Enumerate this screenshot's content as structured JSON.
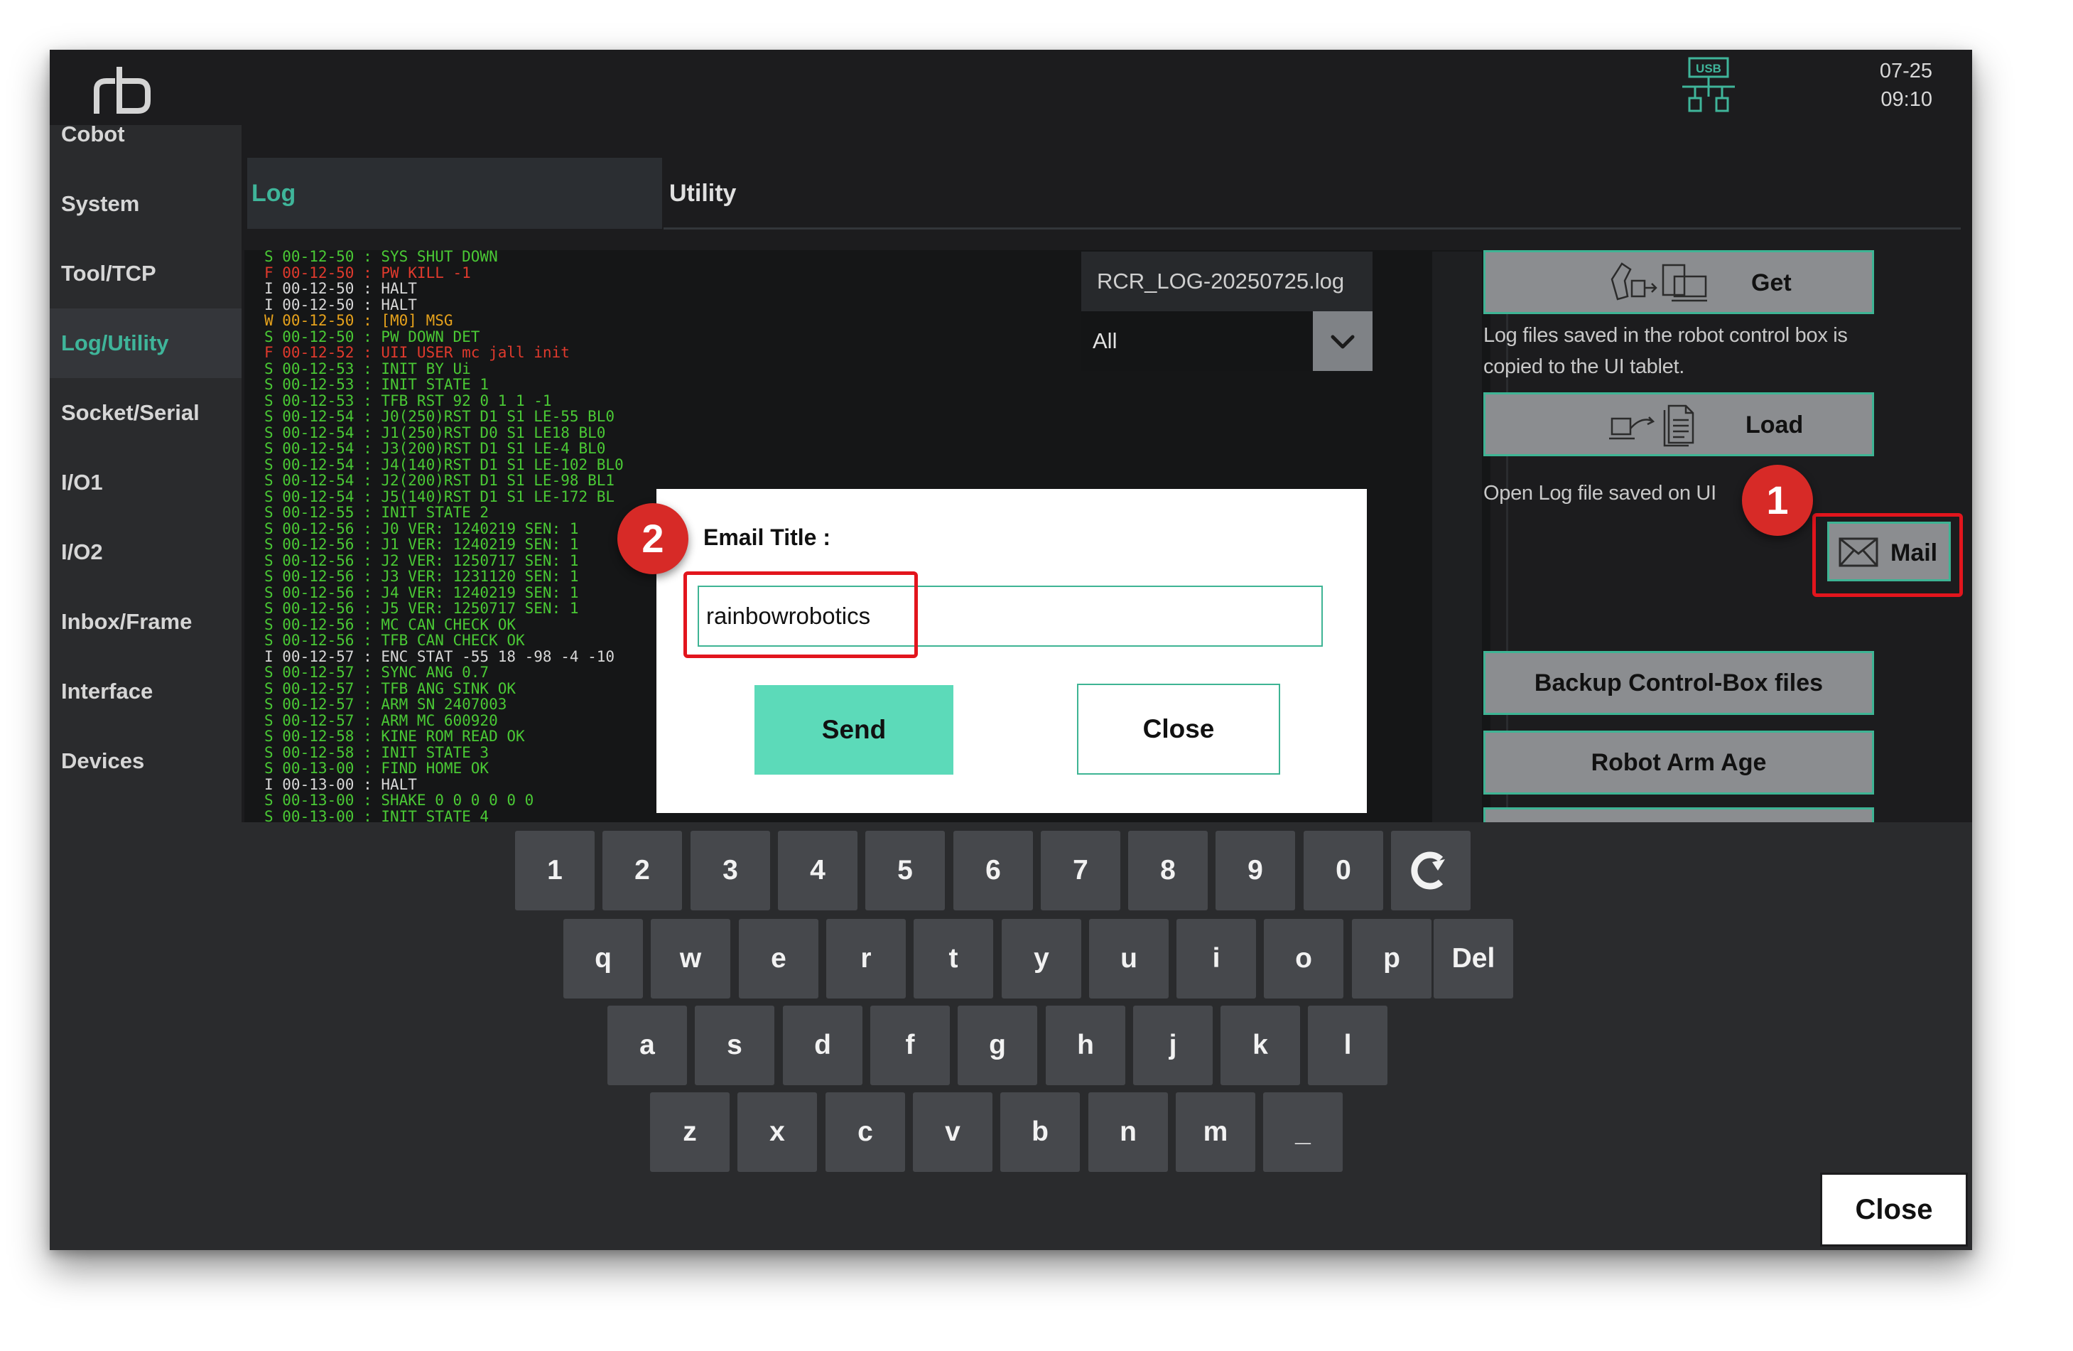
{
  "header": {
    "logo": "rb",
    "date": "07-25",
    "time": "09:10",
    "usb_label": "USB"
  },
  "sidebar": {
    "items": [
      {
        "label": "Cobot"
      },
      {
        "label": "System"
      },
      {
        "label": "Tool/TCP"
      },
      {
        "label": "Log/Utility",
        "active": true
      },
      {
        "label": "Socket/Serial"
      },
      {
        "label": "I/O1"
      },
      {
        "label": "I/O2"
      },
      {
        "label": "Inbox/Frame"
      },
      {
        "label": "Interface"
      },
      {
        "label": "Devices"
      }
    ]
  },
  "tabs": {
    "log": "Log",
    "utility": "Utility"
  },
  "log": {
    "file_name": "RCR_LOG-20250725.log",
    "filter_value": "All",
    "lines": [
      [
        "S",
        "S 00-12-50 : SYS SHUT DOWN"
      ],
      [
        "F",
        "F 00-12-50 : PW KILL -1"
      ],
      [
        "I",
        "I 00-12-50 : HALT"
      ],
      [
        "I",
        "I 00-12-50 : HALT"
      ],
      [
        "W",
        "W 00-12-50 : [M0] MSG"
      ],
      [
        "S",
        "S 00-12-50 : PW DOWN DET"
      ],
      [
        "F",
        "F 00-12-52 : UII USER mc jall init"
      ],
      [
        "S",
        "S 00-12-53 : INIT BY Ui"
      ],
      [
        "S",
        "S 00-12-53 : INIT STATE 1"
      ],
      [
        "S",
        "S 00-12-53 : TFB RST 92 0 1 1 -1"
      ],
      [
        "S",
        "S 00-12-54 : J0(250)RST D1 S1 LE-55 BL0"
      ],
      [
        "S",
        "S 00-12-54 : J1(250)RST D0 S1 LE18 BL0"
      ],
      [
        "S",
        "S 00-12-54 : J3(200)RST D1 S1 LE-4 BL0"
      ],
      [
        "S",
        "S 00-12-54 : J4(140)RST D1 S1 LE-102 BL0"
      ],
      [
        "S",
        "S 00-12-54 : J2(200)RST D1 S1 LE-98 BL1"
      ],
      [
        "S",
        "S 00-12-54 : J5(140)RST D1 S1 LE-172 BL"
      ],
      [
        "S",
        "S 00-12-55 : INIT STATE 2"
      ],
      [
        "S",
        "S 00-12-56 : J0 VER: 1240219 SEN: 1"
      ],
      [
        "S",
        "S 00-12-56 : J1 VER: 1240219 SEN: 1"
      ],
      [
        "S",
        "S 00-12-56 : J2 VER: 1250717 SEN: 1"
      ],
      [
        "S",
        "S 00-12-56 : J3 VER: 1231120 SEN: 1"
      ],
      [
        "S",
        "S 00-12-56 : J4 VER: 1240219 SEN: 1"
      ],
      [
        "S",
        "S 00-12-56 : J5 VER: 1250717 SEN: 1"
      ],
      [
        "S",
        "S 00-12-56 : MC CAN CHECK OK"
      ],
      [
        "S",
        "S 00-12-56 : TFB CAN CHECK OK"
      ],
      [
        "I",
        "I 00-12-57 : ENC STAT -55 18 -98 -4 -10"
      ],
      [
        "S",
        "S 00-12-57 : SYNC ANG 0.7"
      ],
      [
        "S",
        "S 00-12-57 : TFB ANG SINK OK"
      ],
      [
        "S",
        "S 00-12-57 : ARM SN 2407003"
      ],
      [
        "S",
        "S 00-12-57 : ARM MC 600920"
      ],
      [
        "S",
        "S 00-12-58 : KINE ROM READ OK"
      ],
      [
        "S",
        "S 00-12-58 : INIT STATE 3"
      ],
      [
        "S",
        "S 00-13-00 : FIND HOME OK"
      ],
      [
        "I",
        "I 00-13-00 : HALT"
      ],
      [
        "S",
        "S 00-13-00 : SHAKE 0 0 0 0 0 0"
      ],
      [
        "S",
        "S 00-13-00 : INIT STATE 4"
      ]
    ]
  },
  "right_panel": {
    "get_label": "Get",
    "get_desc_1": "Log files saved in the robot control box is",
    "get_desc_2": "copied to the UI tablet.",
    "load_label": "Load",
    "load_desc": "Open Log file saved on UI",
    "mail_label": "Mail",
    "backup_label": "Backup Control-Box files",
    "robot_age_label": "Robot Arm Age"
  },
  "dialog": {
    "title_label": "Email Title :",
    "input_value": "rainbowrobotics",
    "send_label": "Send",
    "close_label": "Close"
  },
  "keyboard": {
    "row1": [
      "1",
      "2",
      "3",
      "4",
      "5",
      "6",
      "7",
      "8",
      "9",
      "0"
    ],
    "row2": [
      "q",
      "w",
      "e",
      "r",
      "t",
      "y",
      "u",
      "i",
      "o",
      "p"
    ],
    "del_label": "Del",
    "row3": [
      "a",
      "s",
      "d",
      "f",
      "g",
      "h",
      "j",
      "k",
      "l"
    ],
    "row4": [
      "z",
      "x",
      "c",
      "v",
      "b",
      "n",
      "m",
      "_"
    ],
    "close_label": "Close"
  },
  "annotations": {
    "step1": "1",
    "step2": "2"
  },
  "colors": {
    "accent": "#3fb59a",
    "send": "#5cdab9",
    "highlight": "#e2151d",
    "badge": "#d72a27"
  }
}
